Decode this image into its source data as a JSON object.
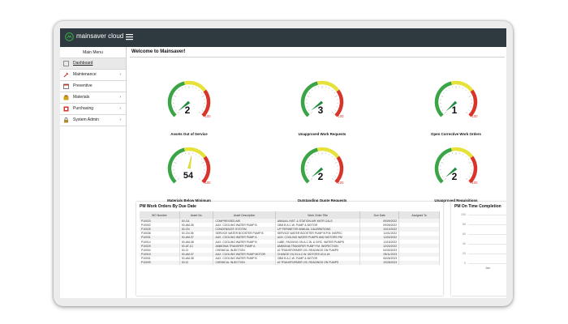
{
  "brand": {
    "name": "mainsaver cloud"
  },
  "sidebar": {
    "title": "Main Menu",
    "items": [
      {
        "label": "Dashboard",
        "icon": "dashboard-icon",
        "chevron": ""
      },
      {
        "label": "Maintenance",
        "icon": "wrench-icon",
        "chevron": "›"
      },
      {
        "label": "Preventive",
        "icon": "calendar-icon",
        "chevron": ""
      },
      {
        "label": "Materials",
        "icon": "materials-icon",
        "chevron": "›"
      },
      {
        "label": "Purchasing",
        "icon": "purchasing-icon",
        "chevron": "›"
      },
      {
        "label": "System Admin",
        "icon": "lock-icon",
        "chevron": "›"
      }
    ]
  },
  "main": {
    "welcome": "Welcome to Mainsaver!"
  },
  "gauges": [
    {
      "label": "Assets Out of Service",
      "value": "2",
      "fraction": 0.02
    },
    {
      "label": "Unapproved Work Requests",
      "value": "3",
      "fraction": 0.03
    },
    {
      "label": "Open Corrective Work Orders",
      "value": "1",
      "fraction": 0.01
    },
    {
      "label": "Materials Below Minimum",
      "value": "54",
      "fraction": 0.54
    },
    {
      "label": "Outstanding Quote Requests",
      "value": "2",
      "fraction": 0.02
    },
    {
      "label": "Unapproved Requisitions",
      "value": "2",
      "fraction": 0.02
    }
  ],
  "gauge_scale": {
    "max_label": "100"
  },
  "colors": {
    "topbar": "#2f3a40",
    "needle": "#1e8b3c",
    "green": "#3aa447",
    "yellow": "#e6e23a",
    "red": "#d8342a"
  },
  "work_orders": {
    "title": "PM Work Orders By Due Date",
    "columns": [
      "WO Number",
      "Asset No.",
      "Asset Description",
      "Work Order Title",
      "Due Date",
      "Assigned To"
    ],
    "rows": [
      [
        "P10023",
        "00-CA",
        "COMPRESSED AIR",
        "ANNUAL INST. & STATION AIR XMTR CALS",
        "09/09/2022",
        ""
      ],
      [
        "P10002",
        "00-AM-38",
        "AUX. COOLING WATER PUMP B",
        "CBM B A.C.W. PUMP & MOTOR",
        "09/26/2022",
        ""
      ],
      [
        "P10025",
        "00-CN",
        "CONDENSATE SYSTEM",
        "L/P PERIMETER ANNUAL CALIBRATIONS",
        "10/10/2022",
        ""
      ],
      [
        "P10036",
        "00-CN-35",
        "SERVICE WATER BOOSTER PUMP B",
        "SERVICE WATER BOOSTER PUMP B P.M. INSPEC",
        "11/01/2022",
        ""
      ],
      [
        "P10031",
        "00-AM-37",
        "AUX. COOLING WATER PUMP A",
        "AUX. COOLING WATER PUMPS AND MOTORS PM",
        "11/02/2022",
        ""
      ],
      [
        "P10014",
        "00-AM-38",
        "AUX. COOLING WATER PUMP B",
        "LUBE, PACKING ON A.C.W. & CIRC. WATER PUMPS",
        "11/15/2022",
        ""
      ],
      [
        "P10029",
        "00-AT-1C",
        "AMMONIA TRANSFER PUMP A",
        "AMMONIA TRANSFER PUMP P.M. INSPECTION",
        "12/20/2022",
        ""
      ],
      [
        "P10004",
        "00-CI",
        "CHEMICAL INJECTION",
        "#2 TRANSFORMER V.B. READINGS ON PUMPS",
        "04/30/2023",
        ""
      ],
      [
        "P10015",
        "00-AM-37",
        "AUX. COOLING WATER PUMP MOTOR",
        "CHANGE OIL IN A.C.W. MOTORS #3 & #4",
        "05/11/2023",
        ""
      ],
      [
        "P10001",
        "00-AM-38",
        "AUX. COOLING WATER PUMP B",
        "CBM B A.C.W. PUMP & MOTOR",
        "06/26/2023",
        ""
      ],
      [
        "P10009",
        "00-CI",
        "CHEMICAL INJECTION",
        "#2 TRANSFORMER V.B. READINGS ON PUMPS",
        "10/28/2023",
        ""
      ]
    ]
  },
  "completion": {
    "title": "PM On Time Completion",
    "y_ticks": [
      "100",
      "80",
      "60",
      "40",
      "20",
      "0"
    ],
    "x_label": "Jan"
  }
}
